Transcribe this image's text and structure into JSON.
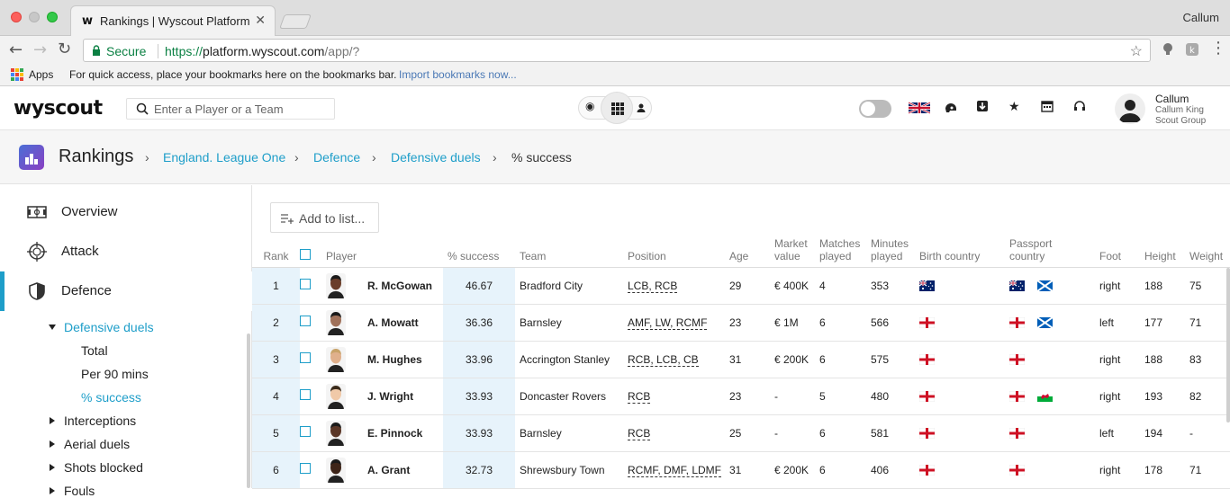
{
  "browser": {
    "tab_title": "Rankings | Wyscout Platform",
    "tab_favicon": "w",
    "tab_close": "✕",
    "profile_name": "Callum",
    "secure_label": "Secure",
    "url_scheme": "https://",
    "url_host": "platform.wyscout.com",
    "url_path": "/app/?",
    "bookmarks": {
      "apps_label": "Apps",
      "hint": "For quick access, place your bookmarks here on the bookmarks bar.",
      "import_link": "Import bookmarks now..."
    }
  },
  "header": {
    "logo": "wyscout",
    "search_placeholder": "Enter a Player or a Team",
    "user": {
      "name": "Callum",
      "full_name": "Callum King",
      "group": "Scout Group"
    }
  },
  "breadcrumb": {
    "title": "Rankings",
    "items": [
      {
        "label": "England. League One"
      },
      {
        "label": "Defence"
      },
      {
        "label": "Defensive duels"
      },
      {
        "label": "% success"
      }
    ]
  },
  "sidebar": {
    "items": [
      {
        "label": "Overview",
        "icon": "pitch-icon"
      },
      {
        "label": "Attack",
        "icon": "crosshair-icon"
      },
      {
        "label": "Defence",
        "icon": "shield-icon"
      }
    ],
    "group": {
      "label": "Defensive duels",
      "children": [
        "Total",
        "Per 90 mins",
        "% success"
      ]
    },
    "collapsed": [
      "Interceptions",
      "Aerial duels",
      "Shots blocked",
      "Fouls"
    ]
  },
  "main": {
    "add_to_list": "Add to list...",
    "columns": {
      "rank": "Rank",
      "player": "Player",
      "success": "% success",
      "team": "Team",
      "position": "Position",
      "age": "Age",
      "market_value_1": "Market",
      "market_value_2": "value",
      "matches_1": "Matches",
      "matches_2": "played",
      "minutes_1": "Minutes",
      "minutes_2": "played",
      "birth_country": "Birth country",
      "passport_1": "Passport",
      "passport_2": "country",
      "foot": "Foot",
      "height": "Height",
      "weight": "Weight"
    },
    "rows": [
      {
        "rank": "1",
        "player": "R. McGowan",
        "success": "46.67",
        "team": "Bradford City",
        "position": "LCB, RCB",
        "age": "29",
        "market_value": "€ 400K",
        "matches": "4",
        "minutes": "353",
        "birth": [
          "australia"
        ],
        "passport": [
          "australia",
          "scotland"
        ],
        "foot": "right",
        "height": "188",
        "weight": "75"
      },
      {
        "rank": "2",
        "player": "A. Mowatt",
        "success": "36.36",
        "team": "Barnsley",
        "position": "AMF, LW, RCMF",
        "age": "23",
        "market_value": "€ 1M",
        "matches": "6",
        "minutes": "566",
        "birth": [
          "england"
        ],
        "passport": [
          "england",
          "scotland"
        ],
        "foot": "left",
        "height": "177",
        "weight": "71"
      },
      {
        "rank": "3",
        "player": "M. Hughes",
        "success": "33.96",
        "team": "Accrington Stanley",
        "position": "RCB, LCB, CB",
        "age": "31",
        "market_value": "€ 200K",
        "matches": "6",
        "minutes": "575",
        "birth": [
          "england"
        ],
        "passport": [
          "england"
        ],
        "foot": "right",
        "height": "188",
        "weight": "83"
      },
      {
        "rank": "4",
        "player": "J. Wright",
        "success": "33.93",
        "team": "Doncaster Rovers",
        "position": "RCB",
        "age": "23",
        "market_value": "-",
        "matches": "5",
        "minutes": "480",
        "birth": [
          "england"
        ],
        "passport": [
          "england",
          "wales"
        ],
        "foot": "right",
        "height": "193",
        "weight": "82"
      },
      {
        "rank": "5",
        "player": "E. Pinnock",
        "success": "33.93",
        "team": "Barnsley",
        "position": "RCB",
        "age": "25",
        "market_value": "-",
        "matches": "6",
        "minutes": "581",
        "birth": [
          "england"
        ],
        "passport": [
          "england"
        ],
        "foot": "left",
        "height": "194",
        "weight": "-"
      },
      {
        "rank": "6",
        "player": "A. Grant",
        "success": "32.73",
        "team": "Shrewsbury Town",
        "position": "RCMF, DMF, LDMF",
        "age": "31",
        "market_value": "€ 200K",
        "matches": "6",
        "minutes": "406",
        "birth": [
          "england"
        ],
        "passport": [
          "england"
        ],
        "foot": "right",
        "height": "178",
        "weight": "71"
      }
    ]
  },
  "colors": {
    "accent": "#1e9ec9",
    "highlight_col": "#e7f3fb"
  }
}
